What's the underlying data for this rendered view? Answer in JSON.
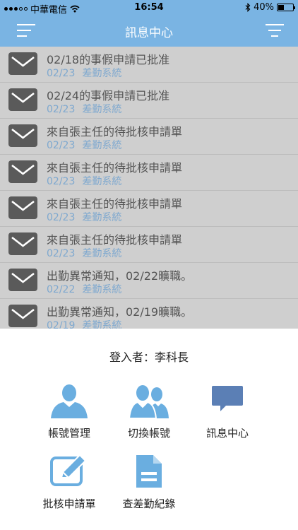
{
  "status_bar": {
    "carrier": "中華電信",
    "time": "16:54",
    "battery": "40%",
    "battery_level": 0.4,
    "icons": [
      "signal-icon",
      "wifi-icon",
      "bluetooth-icon",
      "battery-icon"
    ]
  },
  "header": {
    "title": "訊息中心",
    "left_icon": "menu-icon",
    "right_icon": "filter-icon",
    "background": "#7ab4e3"
  },
  "messages": [
    {
      "title": "02/18的事假申請已批准",
      "date": "02/23",
      "source": "差勤系統"
    },
    {
      "title": "02/24的事假申請已批准",
      "date": "02/23",
      "source": "差勤系統"
    },
    {
      "title": "來自張主任的待批核申請單",
      "date": "02/23",
      "source": "差勤系統"
    },
    {
      "title": "來自張主任的待批核申請單",
      "date": "02/23",
      "source": "差勤系統"
    },
    {
      "title": "來自張主任的待批核申請單",
      "date": "02/23",
      "source": "差勤系統"
    },
    {
      "title": "來自張主任的待批核申請單",
      "date": "02/23",
      "source": "差勤系統"
    },
    {
      "title": "出勤異常通知，02/22曠職。",
      "date": "02/22",
      "source": "差勤系統"
    },
    {
      "title": "出勤異常通知，02/19曠職。",
      "date": "02/19",
      "source": "差勤系統"
    }
  ],
  "sheet": {
    "login_user": "登入者：李科長",
    "actions": [
      {
        "label": "帳號管理",
        "icon": "person-icon"
      },
      {
        "label": "切換帳號",
        "icon": "people-icon"
      },
      {
        "label": "訊息中心",
        "icon": "speech-bubble-icon"
      },
      {
        "label": "批核申請單",
        "icon": "edit-icon"
      },
      {
        "label": "查差勤紀錄",
        "icon": "document-icon"
      }
    ]
  },
  "colors": {
    "accent": "#7ab4e3",
    "icon_blue": "#6aaee0",
    "bubble_blue": "#5b7fb5",
    "meta_text": "#7ea8cf"
  }
}
